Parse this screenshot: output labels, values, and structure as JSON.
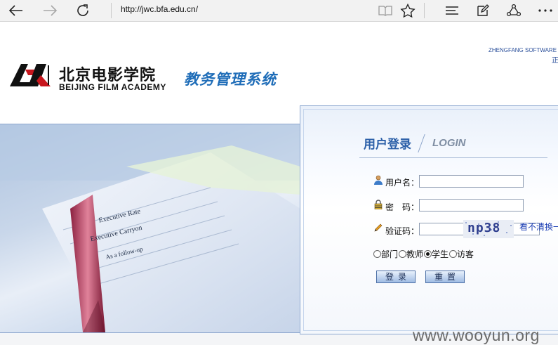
{
  "browser": {
    "url": "http://jwc.bfa.edu.cn/",
    "icons": [
      "back-arrow-icon",
      "forward-arrow-icon",
      "refresh-icon",
      "reading-view-icon",
      "favorite-star-icon",
      "hub-icon",
      "web-note-icon",
      "share-icon",
      "more-icon"
    ]
  },
  "header": {
    "school_cn": "北京电影学院",
    "school_en": "BEIJING FILM ACADEMY",
    "system_title": "教务管理系统",
    "vendor": "ZHENGFANG SOFTWARE",
    "vendor_sub": "正"
  },
  "login": {
    "title_cn": "用户登录",
    "title_en": "LOGIN",
    "username_label": "用户名：",
    "username_value": "",
    "password_label": "密　码：",
    "password_value": "",
    "captcha_label": "验证码：",
    "captcha_value": "",
    "captcha_image_text": "np38",
    "refresh_link": "看不清换一",
    "roles": [
      {
        "label": "部门",
        "checked": false
      },
      {
        "label": "教师",
        "checked": false
      },
      {
        "label": "学生",
        "checked": true
      },
      {
        "label": "访客",
        "checked": false
      }
    ],
    "login_button": "登录",
    "reset_button": "重置"
  },
  "photo_text": {
    "line1": "Executive Rate",
    "line2": "Executive Carryon",
    "line3": "As a follow-up"
  },
  "watermark": "www.wooyun.org",
  "colors": {
    "accent": "#1f6db8",
    "panel_border": "#8ea9d1",
    "link": "#1d3fb5"
  }
}
